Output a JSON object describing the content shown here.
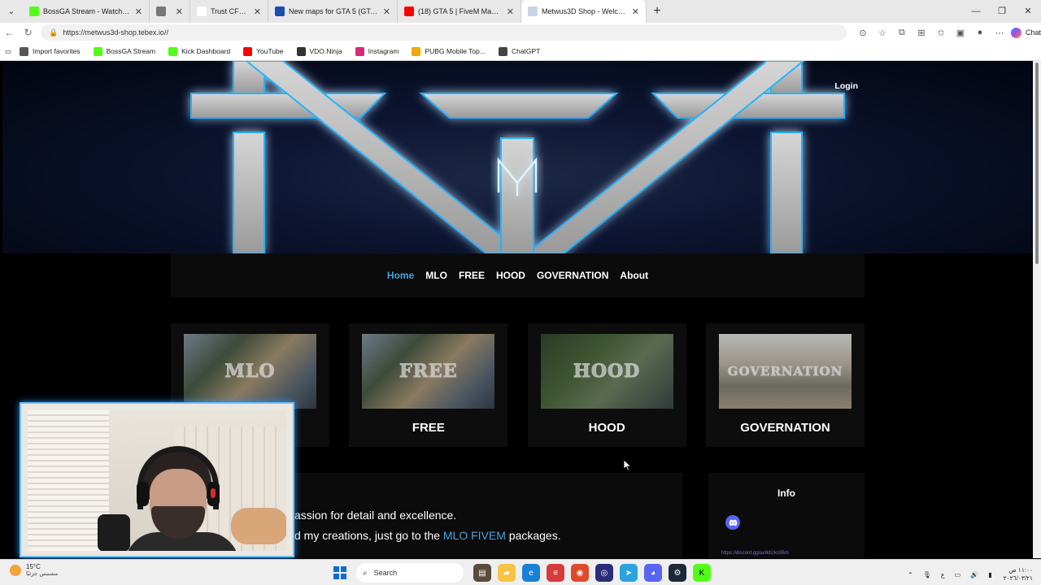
{
  "browser": {
    "tabs": [
      {
        "title": "BossGA Stream - Watch Live on Kick",
        "color": "#53fc18",
        "active": false
      },
      {
        "title": "",
        "color": "#777777",
        "active": false
      },
      {
        "title": "Trust CFW - الستريمرز",
        "color": "#ffffff",
        "active": false
      },
      {
        "title": "New maps for GTA 5 (GTA 5 / New...",
        "color": "#1b4db3",
        "active": false
      },
      {
        "title": "(18) GTA 5 | FiveM Maps | Fuente P",
        "color": "#ff0000",
        "active": false
      },
      {
        "title": "Metwus3D Shop - Welcome",
        "color": "#c9d3e8",
        "active": true
      }
    ],
    "url": "https://metwus3d-shop.tebex.io//",
    "copilot_label": "Chat",
    "favorites": [
      {
        "label": "Import favorites",
        "color": "#555555"
      },
      {
        "label": "BossGA Stream",
        "color": "#53fc18"
      },
      {
        "label": "Kick Dashboard",
        "color": "#53fc18"
      },
      {
        "label": "YouTube",
        "color": "#ff0000"
      },
      {
        "label": "VDO.Ninja",
        "color": "#333333"
      },
      {
        "label": "Instagram",
        "color": "#d62976"
      },
      {
        "label": "PUBG Mobile Top...",
        "color": "#f2a900"
      },
      {
        "label": "ChatGPT",
        "color": "#444444"
      }
    ]
  },
  "site": {
    "login": "Login",
    "nav": [
      {
        "label": "Home",
        "active": true
      },
      {
        "label": "MLO",
        "active": false
      },
      {
        "label": "FREE",
        "active": false
      },
      {
        "label": "HOOD",
        "active": false
      },
      {
        "label": "GOVERNATION",
        "active": false
      },
      {
        "label": "About",
        "active": false
      }
    ],
    "cards": [
      {
        "overlay": "MLO",
        "label": "MLO"
      },
      {
        "overlay": "FREE",
        "label": "FREE"
      },
      {
        "overlay": "HOOD",
        "label": "HOOD"
      },
      {
        "overlay": "GOVERNATION",
        "label": "GOVERNATION"
      }
    ],
    "about": {
      "line1": "assion for detail and excellence.",
      "line2_pre": "d my creations, just go to the ",
      "line2_link": "MLO FIVEM",
      "line2_post": " packages."
    },
    "info": {
      "title": "Info",
      "discord_link": "https://discord.gg/ax8dUkn36m"
    }
  },
  "taskbar": {
    "temp": "15°C",
    "weather": "مشمس جزئيًا",
    "search": "Search",
    "lang": "ع",
    "time": "١١:٠٠ ص",
    "date": "٢٠٢٦/٠٣/٢١"
  }
}
